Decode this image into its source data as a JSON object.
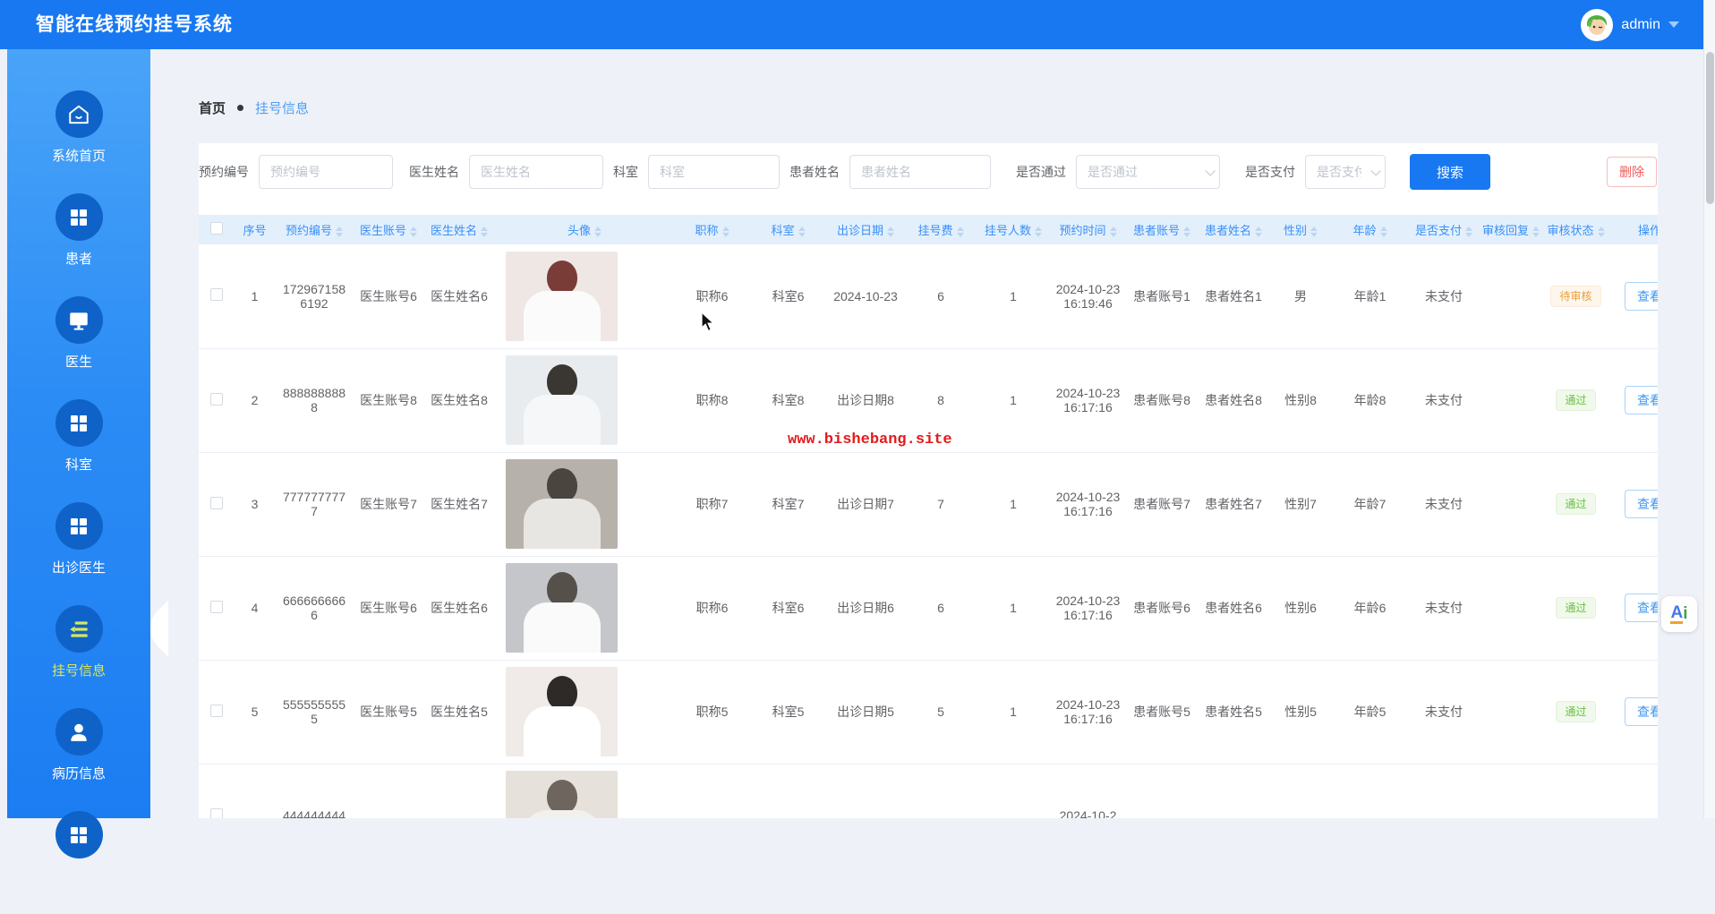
{
  "header": {
    "title": "智能在线预约挂号系统",
    "user": {
      "name": "admin",
      "avatar": "green-hair-cartoon-avatar"
    }
  },
  "sidebar": {
    "items": [
      {
        "label": "系统首页",
        "icon": "home",
        "state": "normal"
      },
      {
        "label": "患者",
        "icon": "grid",
        "state": "normal"
      },
      {
        "label": "医生",
        "icon": "monitor",
        "state": "normal"
      },
      {
        "label": "科室",
        "icon": "grid",
        "state": "normal"
      },
      {
        "label": "出诊医生",
        "icon": "grid",
        "state": "normal"
      },
      {
        "label": "挂号信息",
        "icon": "list",
        "state": "active"
      },
      {
        "label": "病历信息",
        "icon": "user",
        "state": "normal"
      },
      {
        "label": "",
        "icon": "grid",
        "state": "normal"
      }
    ]
  },
  "breadcrumb": {
    "home": "首页",
    "current": "挂号信息"
  },
  "filters": {
    "fields": [
      {
        "label": "预约编号",
        "placeholder": "预约编号",
        "value": "",
        "type": "input"
      },
      {
        "label": "医生姓名",
        "placeholder": "医生姓名",
        "value": "",
        "type": "input"
      },
      {
        "label": "科室",
        "placeholder": "科室",
        "value": "",
        "type": "input"
      },
      {
        "label": "患者姓名",
        "placeholder": "患者姓名",
        "value": "",
        "type": "input"
      },
      {
        "label": "是否通过",
        "placeholder": "是否通过",
        "value": "",
        "type": "select"
      },
      {
        "label": "是否支付",
        "placeholder": "是否支付",
        "value": "",
        "type": "select"
      }
    ],
    "search_label": "搜索",
    "delete_label": "删除"
  },
  "table": {
    "columns": [
      {
        "label": "序号",
        "sortable": false
      },
      {
        "label": "预约编号",
        "sortable": true
      },
      {
        "label": "医生账号",
        "sortable": true
      },
      {
        "label": "医生姓名",
        "sortable": true
      },
      {
        "label": "头像",
        "sortable": true
      },
      {
        "label": "职称",
        "sortable": true
      },
      {
        "label": "科室",
        "sortable": true
      },
      {
        "label": "出诊日期",
        "sortable": true
      },
      {
        "label": "挂号费",
        "sortable": true
      },
      {
        "label": "挂号人数",
        "sortable": true
      },
      {
        "label": "预约时间",
        "sortable": true
      },
      {
        "label": "患者账号",
        "sortable": true
      },
      {
        "label": "患者姓名",
        "sortable": true
      },
      {
        "label": "性别",
        "sortable": true
      },
      {
        "label": "年龄",
        "sortable": true
      },
      {
        "label": "是否支付",
        "sortable": true
      },
      {
        "label": "审核回复",
        "sortable": true
      },
      {
        "label": "审核状态",
        "sortable": true
      },
      {
        "label": "操作",
        "sortable": false
      }
    ],
    "rows": [
      {
        "no": "1",
        "booking": "1729671586192",
        "doctor_account": "医生账号6",
        "doctor_name": "医生姓名6",
        "avatar": "doctor-photo-6",
        "title": "职称6",
        "dept": "科室6",
        "visit_date": "2024-10-23",
        "fee": "6",
        "people": "1",
        "time": "2024-10-23 16:19:46",
        "patient_account": "患者账号1",
        "patient_name": "患者姓名1",
        "gender": "男",
        "age": "年龄1",
        "paid": "未支付",
        "reply": "",
        "status": "待审核",
        "status_type": "warning",
        "action": "查看"
      },
      {
        "no": "2",
        "booking": "8888888888",
        "doctor_account": "医生账号8",
        "doctor_name": "医生姓名8",
        "avatar": "doctor-photo-8",
        "title": "职称8",
        "dept": "科室8",
        "visit_date": "出诊日期8",
        "fee": "8",
        "people": "1",
        "time": "2024-10-23 16:17:16",
        "patient_account": "患者账号8",
        "patient_name": "患者姓名8",
        "gender": "性别8",
        "age": "年龄8",
        "paid": "未支付",
        "reply": "",
        "status": "通过",
        "status_type": "success",
        "action": "查看"
      },
      {
        "no": "3",
        "booking": "7777777777",
        "doctor_account": "医生账号7",
        "doctor_name": "医生姓名7",
        "avatar": "doctor-photo-7",
        "title": "职称7",
        "dept": "科室7",
        "visit_date": "出诊日期7",
        "fee": "7",
        "people": "1",
        "time": "2024-10-23 16:17:16",
        "patient_account": "患者账号7",
        "patient_name": "患者姓名7",
        "gender": "性别7",
        "age": "年龄7",
        "paid": "未支付",
        "reply": "",
        "status": "通过",
        "status_type": "success",
        "action": "查看"
      },
      {
        "no": "4",
        "booking": "6666666666",
        "doctor_account": "医生账号6",
        "doctor_name": "医生姓名6",
        "avatar": "doctor-photo-6b",
        "title": "职称6",
        "dept": "科室6",
        "visit_date": "出诊日期6",
        "fee": "6",
        "people": "1",
        "time": "2024-10-23 16:17:16",
        "patient_account": "患者账号6",
        "patient_name": "患者姓名6",
        "gender": "性别6",
        "age": "年龄6",
        "paid": "未支付",
        "reply": "",
        "status": "通过",
        "status_type": "success",
        "action": "查看"
      },
      {
        "no": "5",
        "booking": "5555555555",
        "doctor_account": "医生账号5",
        "doctor_name": "医生姓名5",
        "avatar": "doctor-photo-5",
        "title": "职称5",
        "dept": "科室5",
        "visit_date": "出诊日期5",
        "fee": "5",
        "people": "1",
        "time": "2024-10-23 16:17:16",
        "patient_account": "患者账号5",
        "patient_name": "患者姓名5",
        "gender": "性别5",
        "age": "年龄5",
        "paid": "未支付",
        "reply": "",
        "status": "通过",
        "status_type": "success",
        "action": "查看"
      },
      {
        "no": "",
        "booking": "444444444",
        "doctor_account": "",
        "doctor_name": "",
        "avatar": "doctor-photo-4",
        "title": "",
        "dept": "",
        "visit_date": "",
        "fee": "",
        "people": "",
        "time": "2024-10-2",
        "patient_account": "",
        "patient_name": "",
        "gender": "",
        "age": "",
        "paid": "",
        "reply": "",
        "status": "",
        "status_type": "none",
        "action": ""
      }
    ]
  },
  "watermark": "www.bishebang.site",
  "ai_widget": {
    "letter_a": "A",
    "letter_i": "i"
  },
  "colors": {
    "primary": "#1778f2",
    "active_menu": "#d9e65a",
    "tag_warning": "#e6a23c",
    "tag_success": "#67c23a",
    "danger": "#f05b5b"
  }
}
